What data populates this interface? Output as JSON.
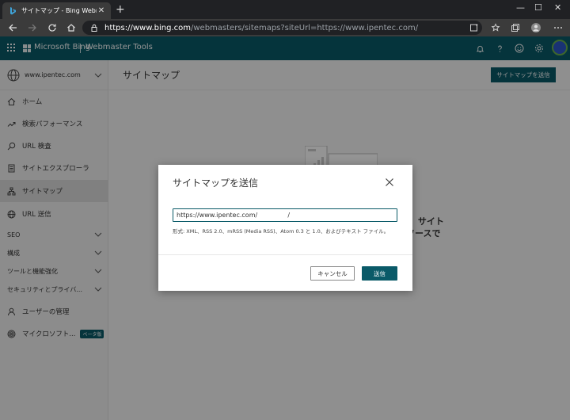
{
  "browser": {
    "tab_title": "サイトマップ - Bing Webmaster Too",
    "tab_close": "✕",
    "new_tab": "+",
    "url_host": "https://www.bing.com",
    "url_rest": "/webmasters/sitemaps?siteUrl=https://www.ipentec.com/",
    "window_controls": [
      "—",
      "☐",
      "✕"
    ]
  },
  "header": {
    "brand": "Microsoft Bing",
    "product": "Webmaster Tools",
    "accent_color": "#0a5a68"
  },
  "sidebar": {
    "site_name": "www.ipentec.com",
    "items": [
      {
        "label": "ホーム",
        "icon": "home-icon"
      },
      {
        "label": "検索パフォーマンス",
        "icon": "trend-icon"
      },
      {
        "label": "URL 検査",
        "icon": "search-icon"
      },
      {
        "label": "サイトエクスプローラ",
        "icon": "document-icon"
      },
      {
        "label": "サイトマップ",
        "icon": "sitemap-icon",
        "active": true
      },
      {
        "label": "URL 送信",
        "icon": "globe-icon"
      }
    ],
    "sections": [
      {
        "label": "SEO"
      },
      {
        "label": "構成"
      },
      {
        "label": "ツールと機能強化"
      },
      {
        "label": "セキュリティとプライバ..."
      }
    ],
    "bottom_items": [
      {
        "label": "ユーザーの管理",
        "icon": "user-icon"
      },
      {
        "label": "マイクロソフト...",
        "icon": "fingerprint-icon",
        "badge": "ベータ版"
      }
    ]
  },
  "main": {
    "title": "サイトマップ",
    "submit_label": "サイトマップを送信",
    "empty_line1": "。 サイト",
    "empty_line2": "ソースで",
    "empty_line3": "。"
  },
  "dialog": {
    "title": "サイトマップを送信",
    "input_value": "https://www.ipentec.com/               /",
    "hint": "形式: XML、RSS 2.0、mRSS (Media RSS)、Atom 0.3 と 1.0、およびテキスト ファイル。",
    "cancel_label": "キャンセル",
    "send_label": "送信"
  }
}
